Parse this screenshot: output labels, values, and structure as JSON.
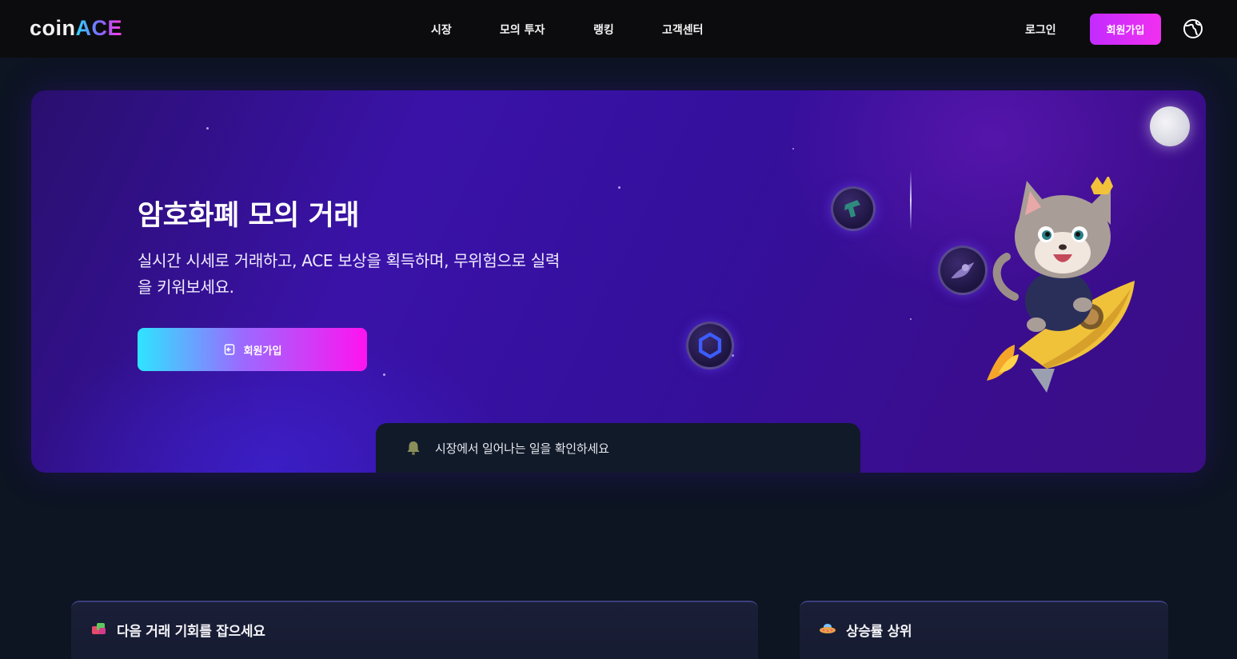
{
  "header": {
    "logo_left": "coin",
    "logo_right": "ACE",
    "nav": [
      {
        "label": "시장",
        "id": "market"
      },
      {
        "label": "모의 투자",
        "id": "mock-trading"
      },
      {
        "label": "랭킹",
        "id": "ranking"
      },
      {
        "label": "고객센터",
        "id": "support"
      }
    ],
    "login_label": "로그인",
    "signup_label": "회원가입",
    "language_icon": "globe-icon"
  },
  "hero": {
    "title": "암호화폐 모의 거래",
    "subtitle": "실시간 시세로 거래하고, ACE 보상을 획득하며, 무위험으로 실력을 키워보세요.",
    "cta_label": "회원가입",
    "cta_icon": "signup-icon"
  },
  "ticker": {
    "icon": "bell-icon",
    "text": "시장에서 일어나는 일을 확인하세요"
  },
  "panels": {
    "opportunity": {
      "title": "다음 거래 기회를 잡으세요",
      "icon": "gift-icon"
    },
    "top_gainers": {
      "title": "상승률 상위",
      "icon": "ufo-icon"
    }
  },
  "colors": {
    "background": "#0d1422",
    "header_bg": "#0c0c0e",
    "accent_pink": "#f12ff0",
    "accent_cyan": "#2ee4ff",
    "hero_purple": "#3a12a8"
  }
}
